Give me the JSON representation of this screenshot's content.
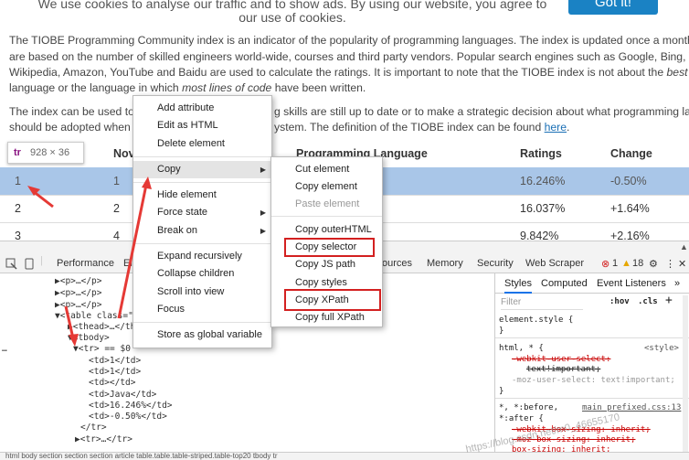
{
  "cookie": {
    "text": "We use cookies to analyse our traffic and to show ads. By using our website, you agree to our use of cookies.",
    "button": "Got it!"
  },
  "page": {
    "p1_lines": [
      "The TIOBE Programming Community index is an indicator of the popularity of programming languages. The index is updated once a month. The ratings",
      "are based on the number of skilled engineers world-wide, courses and third party vendors. Popular search engines such as Google, Bing, Yahoo!,",
      "Wikipedia, Amazon, YouTube and Baidu are used to calculate the ratings. It is important to note that the TIOBE index is not about the",
      "best",
      "programming",
      "language or the language in which",
      "most lines of code",
      "have been written."
    ],
    "p2_line1_left": "The index can be used to ch",
    "p2_line1_right": "g skills are still up to date or to make a strategic decision about what programming language",
    "p2_line2_left": "should be adopted when sta",
    "p2_line2_right": "ystem. The definition of the TIOBE index can be found",
    "p2_link": "here",
    "p2_end": "."
  },
  "table": {
    "headers": {
      "nov": "Nov",
      "lang": "Programming Language",
      "ratings": "Ratings",
      "change": "Change"
    },
    "rows": [
      {
        "rank": "1",
        "prev": "1",
        "rating": "16.246%",
        "change": "-0.50%"
      },
      {
        "rank": "2",
        "prev": "2",
        "rating": "16.037%",
        "change": "+1.64%"
      },
      {
        "rank": "3",
        "prev": "4",
        "rating": "9.842%",
        "change": "+2.16%"
      }
    ]
  },
  "tooltip": {
    "tag": "tr",
    "size": "928 × 36"
  },
  "devtools": {
    "tabs": [
      "Performance",
      "El",
      "ources",
      "Memory",
      "Security",
      "Web Scraper"
    ],
    "errors": "1",
    "warnings": "18",
    "elements_lines": [
      "▶<p>…</p>",
      "▶<p>…</p>",
      "▶<p>…</p>",
      "▼<table class=\"t",
      "▶<thead>…</th",
      "▼<tbody>",
      "▼<tr> == $0",
      "<td>1</td>",
      "<td>1</td>",
      "<td></td>",
      "<td>Java</td>",
      "<td>16.246%</td>",
      "<td>-0.50%</td>",
      "</tr>",
      "▶<tr>…</tr>"
    ],
    "ellipsis": "…",
    "styles_tabs": [
      "Styles",
      "Computed",
      "Event Listeners",
      "»"
    ],
    "filter_placeholder": "Filter",
    "hov": ":hov",
    "cls": ".cls",
    "plus": "+",
    "rules": [
      "element.style {",
      "}",
      "html, * {",
      "<style>",
      "-webkit-user-select:",
      "text!important;",
      "-moz-user-select: text!important;",
      "}",
      "*, *:before,",
      "main_prefixed.css:13",
      "*:after {",
      "-webkit-box-sizing: inherit;",
      "-moz-box-sizing: inherit;",
      "box-sizing: inherit;"
    ],
    "breadcrumb": "html   body   section   section   section   article   table.table.table-striped.table-top20   tbody   tr",
    "watermark": "https://blog.csdn.net/m0_46655170"
  },
  "context_menu": {
    "items": [
      "Add attribute",
      "Edit as HTML",
      "Delete element",
      "Copy",
      "Hide element",
      "Force state",
      "Break on",
      "Expand recursively",
      "Collapse children",
      "Scroll into view",
      "Focus",
      "Store as global variable"
    ]
  },
  "copy_submenu": {
    "items": [
      "Cut element",
      "Copy element",
      "Paste element",
      "Copy outerHTML",
      "Copy selector",
      "Copy JS path",
      "Copy styles",
      "Copy XPath",
      "Copy full XPath"
    ]
  },
  "colors": {
    "highlight_row": "#a9c6e8",
    "annotation_red": "#d32020",
    "link_blue": "#1a6fb5"
  }
}
